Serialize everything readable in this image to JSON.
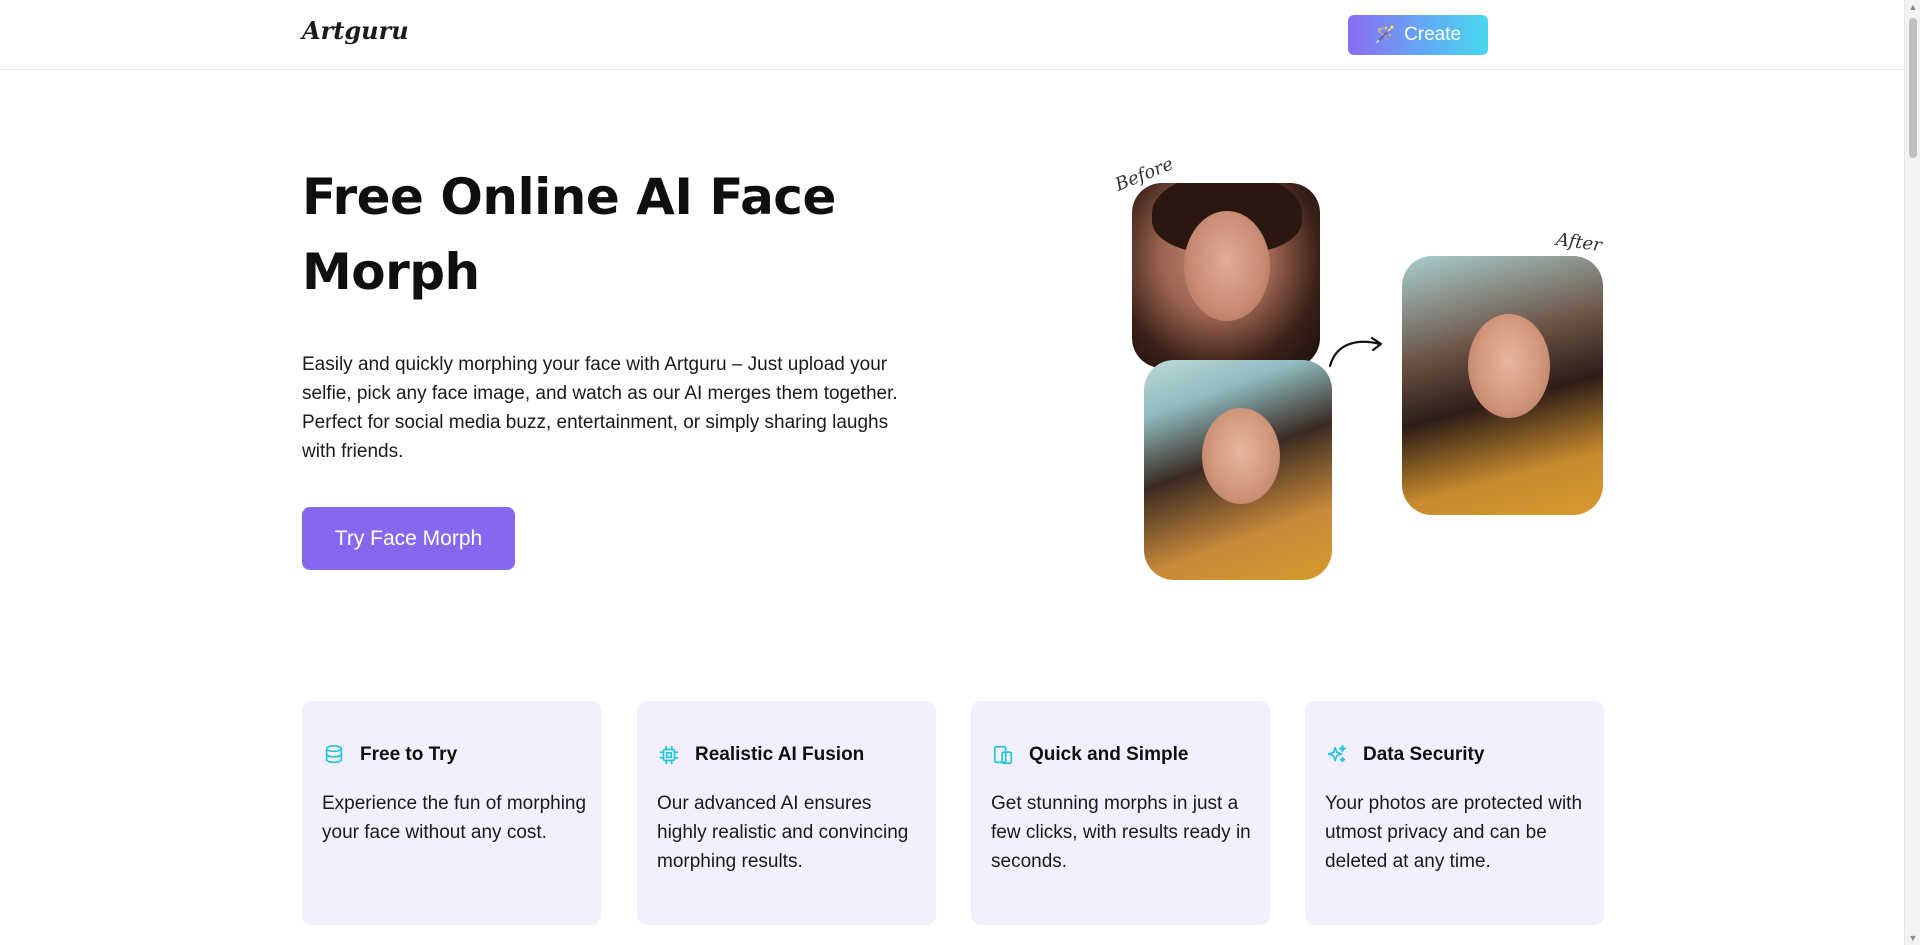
{
  "header": {
    "logo": "Artguru",
    "create_label": "Create",
    "create_icon": "magic-wand-icon"
  },
  "hero": {
    "title": "Free Online AI Face Morph",
    "description": "Easily and quickly morphing your face with Artguru – Just upload your selfie, pick any face image, and watch as our AI merges them together. Perfect for social media buzz, entertainment, or simply sharing laughs with friends.",
    "cta_label": "Try Face Morph",
    "before_label": "Before",
    "after_label": "After"
  },
  "features": [
    {
      "icon": "database-icon",
      "title": "Free to Try",
      "text": "Experience the fun of morphing your face without any cost."
    },
    {
      "icon": "cpu-chip-icon",
      "title": "Realistic AI Fusion",
      "text": "Our advanced AI ensures highly realistic and convincing morphing results."
    },
    {
      "icon": "devices-icon",
      "title": "Quick and Simple",
      "text": "Get stunning morphs in just a few clicks, with results ready in seconds."
    },
    {
      "icon": "sparkles-icon",
      "title": "Data Security",
      "text": "Your photos are protected with utmost privacy and can be deleted at any time."
    }
  ],
  "colors": {
    "accent": "#8668ef",
    "icon": "#1cc7d9",
    "card_bg": "#f3effe"
  }
}
